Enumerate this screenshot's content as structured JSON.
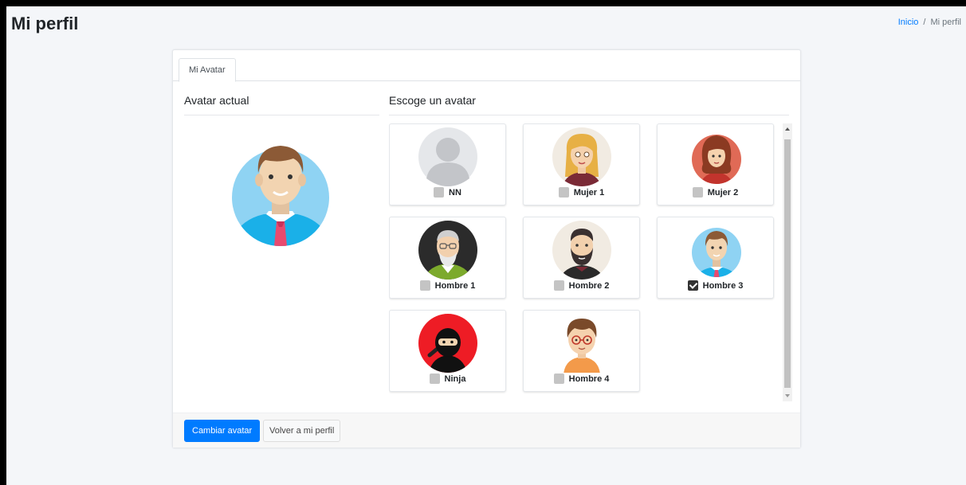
{
  "page": {
    "title": "Mi perfil",
    "breadcrumb": {
      "home": "Inicio",
      "separator": "/",
      "current": "Mi perfil"
    }
  },
  "tabs": [
    {
      "label": "Mi Avatar",
      "active": true
    }
  ],
  "current_avatar": {
    "heading": "Avatar actual",
    "avatar": "Hombre 3"
  },
  "chooser": {
    "heading": "Escoge un avatar",
    "options": [
      {
        "label": "NN",
        "checked": false
      },
      {
        "label": "Mujer 1",
        "checked": false
      },
      {
        "label": "Mujer 2",
        "checked": false
      },
      {
        "label": "Hombre 1",
        "checked": false
      },
      {
        "label": "Hombre 2",
        "checked": false
      },
      {
        "label": "Hombre 3",
        "checked": true
      },
      {
        "label": "Ninja",
        "checked": false
      },
      {
        "label": "Hombre 4",
        "checked": false
      }
    ]
  },
  "footer": {
    "primary_button": "Cambiar avatar",
    "secondary_button": "Volver a mi perfil"
  },
  "colors": {
    "primary": "#007bff",
    "link": "#007bff",
    "page_background": "#f4f6f9"
  }
}
